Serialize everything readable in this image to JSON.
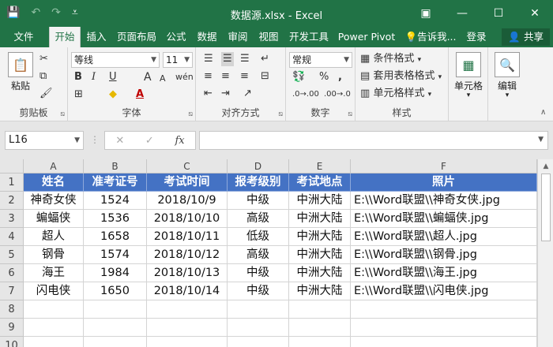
{
  "titlebar": {
    "title": "数据源.xlsx - Excel",
    "save_icon": "💾",
    "undo_icon": "↶",
    "redo_icon": "↷",
    "customize_icon": "⩡",
    "ribbon_display_icon": "▣",
    "minimize_icon": "—",
    "maximize_icon": "☐",
    "close_icon": "✕"
  },
  "tabs": [
    {
      "label": "文件"
    },
    {
      "label": "开始"
    },
    {
      "label": "插入"
    },
    {
      "label": "页面布局"
    },
    {
      "label": "公式"
    },
    {
      "label": "数据"
    },
    {
      "label": "审阅"
    },
    {
      "label": "视图"
    },
    {
      "label": "开发工具"
    },
    {
      "label": "Power Pivot"
    },
    {
      "label": "告诉我..."
    },
    {
      "label": "登录"
    }
  ],
  "share_label": "共享",
  "ribbon": {
    "clipboard": {
      "label": "剪贴板",
      "paste": "粘贴"
    },
    "font": {
      "label": "字体",
      "font_name": "等线",
      "font_size": "11",
      "bold": "B",
      "italic": "I",
      "underline": "U",
      "grow": "A",
      "shrink": "A"
    },
    "alignment": {
      "label": "对齐方式"
    },
    "number": {
      "label": "数字",
      "format": "常规",
      "percent": "%",
      "comma": ","
    },
    "styles": {
      "label": "样式",
      "conditional": "条件格式",
      "table": "套用表格格式",
      "cell_styles": "单元格样式"
    },
    "cells": {
      "label": "单元格"
    },
    "editing": {
      "label": "编辑"
    }
  },
  "formula_bar": {
    "name_box": "L16",
    "cancel_icon": "✕",
    "enter_icon": "✓",
    "fx_icon": "fx"
  },
  "sheet": {
    "columns": [
      "A",
      "B",
      "C",
      "D",
      "E",
      "F"
    ],
    "rows": [
      "1",
      "2",
      "3",
      "4",
      "5",
      "6",
      "7",
      "8",
      "9",
      "10"
    ],
    "header": [
      "姓名",
      "准考证号",
      "考试时间",
      "报考级别",
      "考试地点",
      "照片"
    ],
    "data": [
      [
        "神奇女侠",
        "1524",
        "2018/10/9",
        "中级",
        "中洲大陆",
        "E:\\\\Word联盟\\\\神奇女侠.jpg"
      ],
      [
        "蝙蝠侠",
        "1536",
        "2018/10/10",
        "高级",
        "中洲大陆",
        "E:\\\\Word联盟\\\\蝙蝠侠.jpg"
      ],
      [
        "超人",
        "1658",
        "2018/10/11",
        "低级",
        "中洲大陆",
        "E:\\\\Word联盟\\\\超人.jpg"
      ],
      [
        "钢骨",
        "1574",
        "2018/10/12",
        "高级",
        "中洲大陆",
        "E:\\\\Word联盟\\\\钢骨.jpg"
      ],
      [
        "海王",
        "1984",
        "2018/10/13",
        "中级",
        "中洲大陆",
        "E:\\\\Word联盟\\\\海王.jpg"
      ],
      [
        "闪电侠",
        "1650",
        "2018/10/14",
        "中级",
        "中洲大陆",
        "E:\\\\Word联盟\\\\闪电侠.jpg"
      ]
    ]
  },
  "colors": {
    "excel_green": "#217346",
    "header_fill": "#4472c4"
  }
}
